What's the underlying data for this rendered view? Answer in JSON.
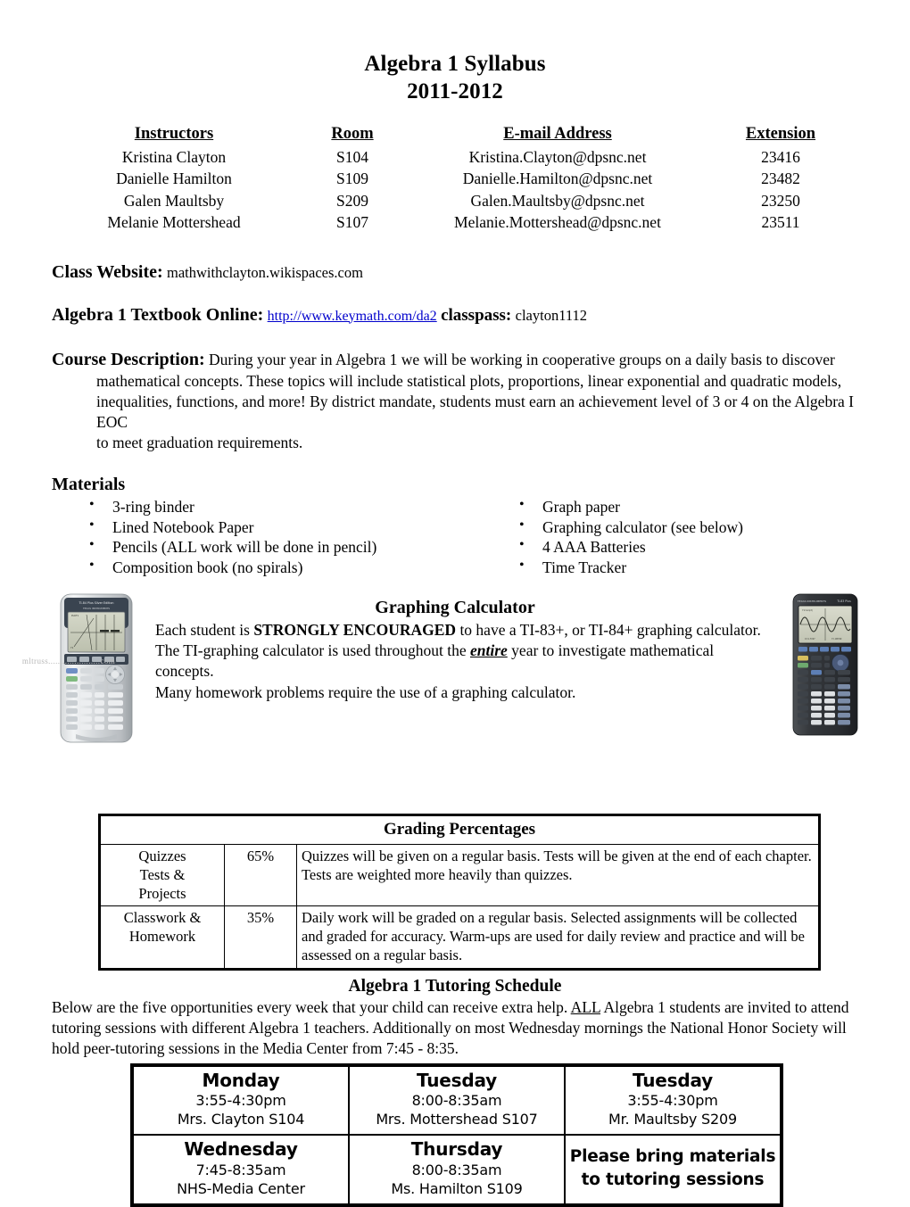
{
  "title": {
    "line1": "Algebra 1 Syllabus",
    "line2": "2011-2012"
  },
  "instructors_table": {
    "headers": [
      "Instructors",
      "Room",
      "E-mail Address",
      "Extension"
    ],
    "rows": [
      {
        "name": "Kristina Clayton",
        "room": "S104",
        "email": "Kristina.Clayton@dpsnc.net",
        "ext": "23416"
      },
      {
        "name": "Danielle Hamilton",
        "room": "S109",
        "email": "Danielle.Hamilton@dpsnc.net",
        "ext": "23482"
      },
      {
        "name": "Galen Maultsby",
        "room": "S209",
        "email": "Galen.Maultsby@dpsnc.net",
        "ext": "23250"
      },
      {
        "name": "Melanie Mottershead",
        "room": "S107",
        "email": "Melanie.Mottershead@dpsnc.net",
        "ext": "23511"
      }
    ]
  },
  "website": {
    "label": "Class Website:",
    "value": "mathwithclayton.wikispaces.com"
  },
  "textbook": {
    "label": "Algebra 1 Textbook Online:",
    "link_text": "http://www.keymath.com/da2",
    "classpass_label": "classpass:",
    "classpass_value": "clayton1112"
  },
  "course_description": {
    "label": "Course Description:",
    "line1": "During your year in Algebra 1 we will be working in cooperative groups on a daily basis to discover",
    "line2": "mathematical concepts.  These topics will include statistical plots, proportions, linear exponential and quadratic models,",
    "line3": "inequalities, functions, and more!  By district mandate, students must earn an achievement level of 3 or 4 on the Algebra I EOC",
    "line4": "to meet graduation requirements."
  },
  "materials": {
    "heading": "Materials",
    "left_items": [
      "3-ring binder",
      "Lined Notebook Paper",
      "Pencils (ALL work will be done in pencil)",
      "Composition book (no spirals)"
    ],
    "right_items": [
      "Graph paper",
      "Graphing calculator (see below)",
      "4 AAA Batteries",
      "Time Tracker"
    ]
  },
  "graphing_calculator": {
    "heading": "Graphing Calculator",
    "line1_a": "Each student is ",
    "line1_bold": "STRONGLY ENCOURAGED",
    "line1_b": " to have a TI-83+, or TI-84+ graphing calculator.",
    "line2_a": "The TI-graphing calculator is used throughout the ",
    "line2_emph": "entire",
    "line2_b": " year to investigate mathematical concepts.",
    "line3": "Many homework problems require the use of a graphing calculator.",
    "watermark": "mltruss......................com"
  },
  "grading": {
    "title": "Grading Percentages",
    "rows": [
      {
        "category": [
          "Quizzes",
          "Tests &",
          "Projects"
        ],
        "percent": "65%",
        "description": "Quizzes will be given on a regular basis.  Tests will be given at the end of each chapter.  Tests are weighted more heavily than quizzes."
      },
      {
        "category": [
          "Classwork &",
          "Homework"
        ],
        "percent": "35%",
        "description": "Daily work will be graded on a regular basis.  Selected assignments will be collected and graded for accuracy.  Warm-ups are used for daily review and practice and will be assessed on a regular basis."
      }
    ]
  },
  "tutoring": {
    "heading": "Algebra 1 Tutoring Schedule",
    "intro_a": "Below are the five opportunities every week that your child can receive extra help.  ",
    "intro_all": "ALL",
    "intro_b": " Algebra 1 students are invited to attend tutoring sessions with different Algebra 1 teachers.  Additionally on most Wednesday mornings the National Honor Society will hold peer-tutoring sessions in the Media Center from 7:45 - 8:35.",
    "cells": [
      {
        "day": "Monday",
        "time": "3:55-4:30pm",
        "who": "Mrs. Clayton S104"
      },
      {
        "day": "Tuesday",
        "time": "8:00-8:35am",
        "who": "Mrs. Mottershead S107"
      },
      {
        "day": "Tuesday",
        "time": "3:55-4:30pm",
        "who": "Mr. Maultsby S209"
      },
      {
        "day": "Wednesday",
        "time": "7:45-8:35am",
        "who": "NHS-Media Center"
      },
      {
        "day": "Thursday",
        "time": "8:00-8:35am",
        "who": "Ms. Hamilton S109"
      }
    ],
    "note_line1": "Please bring materials",
    "note_line2": "to tutoring sessions"
  }
}
